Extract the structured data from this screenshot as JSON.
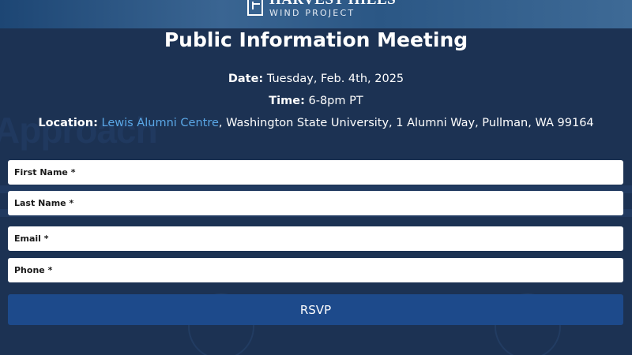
{
  "header": {
    "logo_name": "HARVEST HILLS",
    "logo_sub": "WIND PROJECT"
  },
  "background": {
    "heading": "Approach"
  },
  "event": {
    "title": "Public Information Meeting",
    "date_label": "Date:",
    "date_value": "Tuesday, Feb. 4th, 2025",
    "time_label": "Time:",
    "time_value": "6-8pm PT",
    "location_label": "Location:",
    "location_link": "Lewis Alumni Centre",
    "location_rest": ", Washington State University, 1 Alumni Way, Pullman, WA 99164"
  },
  "form": {
    "first_name_placeholder": "First Name *",
    "last_name_placeholder": "Last Name *",
    "email_placeholder": "Email *",
    "phone_placeholder": "Phone *",
    "submit_label": "RSVP"
  },
  "colors": {
    "background": "#1c3253",
    "button": "#1d4a8b",
    "link": "#5aa7e6"
  }
}
